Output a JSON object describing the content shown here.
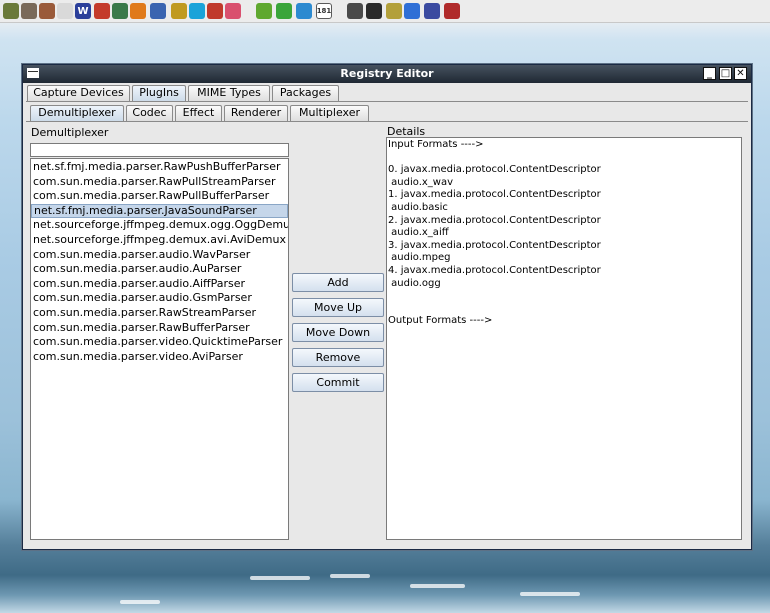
{
  "taskbar": {
    "icons": [
      {
        "name": "file-manager-icon",
        "color": "#6b7a3a"
      },
      {
        "name": "text-editor-icon",
        "color": "#7a6a5a"
      },
      {
        "name": "tools-icon",
        "color": "#9a5a3a"
      },
      {
        "name": "cd-icon",
        "color": "#d9d9d9"
      },
      {
        "name": "word-processor-icon",
        "color": "#2b3f9a"
      },
      {
        "name": "mail-icon",
        "color": "#c43a2a"
      },
      {
        "name": "network-icon",
        "color": "#3a7a4a"
      },
      {
        "name": "firefox-icon",
        "color": "#e07a1a"
      },
      {
        "name": "thunderbird-icon",
        "color": "#3a64b0"
      },
      {
        "name": "person-icon",
        "color": "#c09a20"
      },
      {
        "name": "skype-icon",
        "color": "#1aa3d9"
      },
      {
        "name": "calculator-icon",
        "color": "#c0392b"
      },
      {
        "name": "chat-icon",
        "color": "#d9506e"
      },
      {
        "name": "music-icon",
        "color": "#5fa82f"
      },
      {
        "name": "media-player-icon",
        "color": "#3aa53a"
      },
      {
        "name": "browser-icon",
        "color": "#2c8ad0"
      },
      {
        "name": "calendar-icon",
        "color": "#5a5a5a"
      },
      {
        "name": "lock-icon",
        "color": "#4a4a4a"
      },
      {
        "name": "terminal-icon",
        "color": "#2a2a2a"
      },
      {
        "name": "settings-icon",
        "color": "#b3a03a"
      },
      {
        "name": "monitor-icon",
        "color": "#2f6fd6"
      },
      {
        "name": "orb-icon",
        "color": "#3a4aa0"
      },
      {
        "name": "apple-icon",
        "color": "#b02a2a"
      }
    ],
    "calendar_text": "181"
  },
  "window": {
    "title": "Registry Editor"
  },
  "tabs": [
    "Capture Devices",
    "PlugIns",
    "MIME Types",
    "Packages"
  ],
  "subtabs": [
    "Demultiplexer",
    "Codec",
    "Effect",
    "Renderer",
    "Multiplexer"
  ],
  "left": {
    "heading": "Demultiplexer",
    "filter_value": "",
    "items": [
      "net.sf.fmj.media.parser.RawPushBufferParser",
      "com.sun.media.parser.RawPullStreamParser",
      "com.sun.media.parser.RawPullBufferParser",
      "net.sf.fmj.media.parser.JavaSoundParser",
      "net.sourceforge.jffmpeg.demux.ogg.OggDemux",
      "net.sourceforge.jffmpeg.demux.avi.AviDemux",
      "com.sun.media.parser.audio.WavParser",
      "com.sun.media.parser.audio.AuParser",
      "com.sun.media.parser.audio.AiffParser",
      "com.sun.media.parser.audio.GsmParser",
      "com.sun.media.parser.RawStreamParser",
      "com.sun.media.parser.RawBufferParser",
      "com.sun.media.parser.video.QuicktimeParser",
      "com.sun.media.parser.video.AviParser"
    ],
    "selected": "net.sf.fmj.media.parser.JavaSoundParser"
  },
  "buttons": {
    "add": "Add",
    "move_up": "Move Up",
    "move_down": "Move Down",
    "remove": "Remove",
    "commit": "Commit"
  },
  "details": {
    "heading": "Details",
    "lines": [
      "Input Formats ---->",
      "",
      "0. javax.media.protocol.ContentDescriptor",
      " audio.x_wav",
      "1. javax.media.protocol.ContentDescriptor",
      " audio.basic",
      "2. javax.media.protocol.ContentDescriptor",
      " audio.x_aiff",
      "3. javax.media.protocol.ContentDescriptor",
      " audio.mpeg",
      "4. javax.media.protocol.ContentDescriptor",
      " audio.ogg",
      "",
      "",
      "Output Formats ---->"
    ]
  }
}
